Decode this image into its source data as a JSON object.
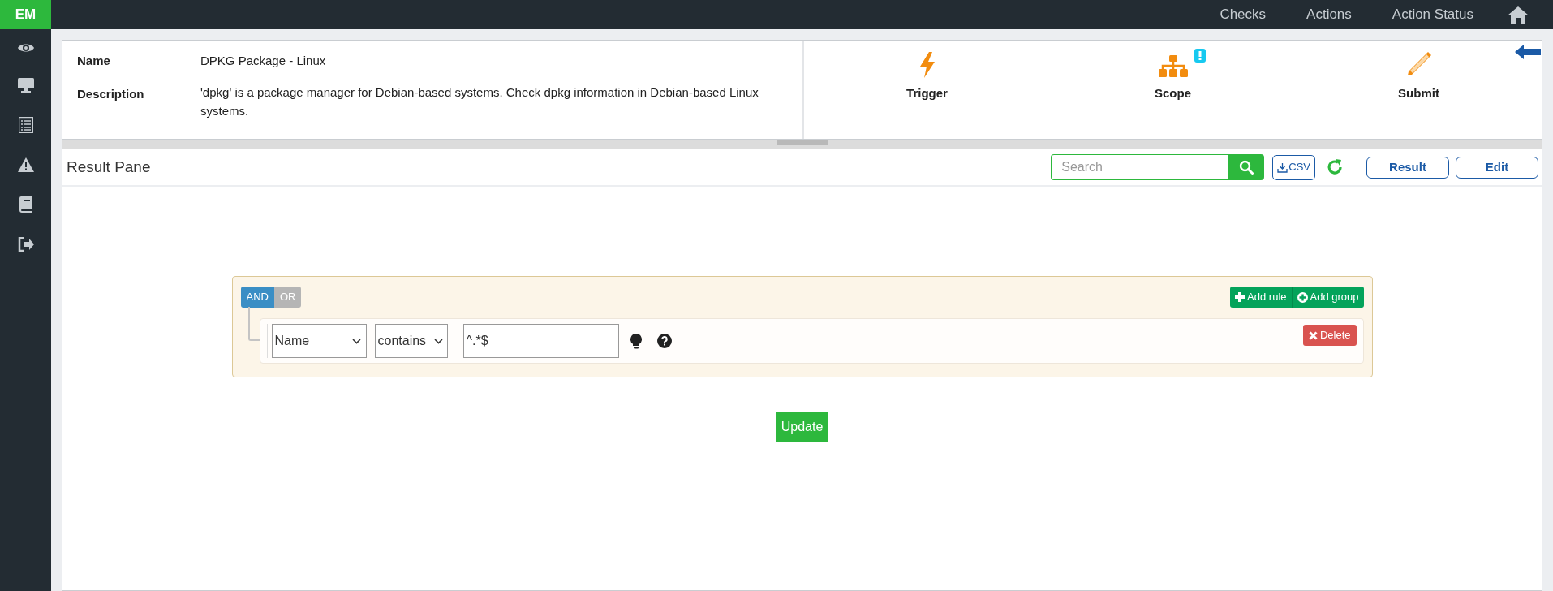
{
  "brand": "EM",
  "nav": [
    "Checks",
    "Actions",
    "Action Status"
  ],
  "info": {
    "name_label": "Name",
    "name_value": "DPKG Package - Linux",
    "description_label": "Description",
    "description_value": "'dpkg' is a package manager for Debian-based systems. Check dpkg information in Debian-based Linux systems."
  },
  "steps": [
    {
      "kind": "trigger",
      "label": "Trigger",
      "alert": false
    },
    {
      "kind": "scope",
      "label": "Scope",
      "alert": true
    },
    {
      "kind": "submit",
      "label": "Submit",
      "alert": false
    }
  ],
  "result_pane": {
    "title": "Result Pane",
    "search": {
      "placeholder": "Search"
    },
    "csv": "CSV",
    "buttons": [
      "Result",
      "Edit"
    ]
  },
  "query": {
    "conditions": [
      {
        "label": "AND",
        "selected": true
      },
      {
        "label": "OR",
        "selected": false
      }
    ],
    "add_rule": "Add rule",
    "add_group": "Add group",
    "rules": [
      {
        "field": "Name",
        "operator": "contains",
        "value": "^.*$",
        "delete": "Delete"
      }
    ]
  },
  "update": "Update"
}
